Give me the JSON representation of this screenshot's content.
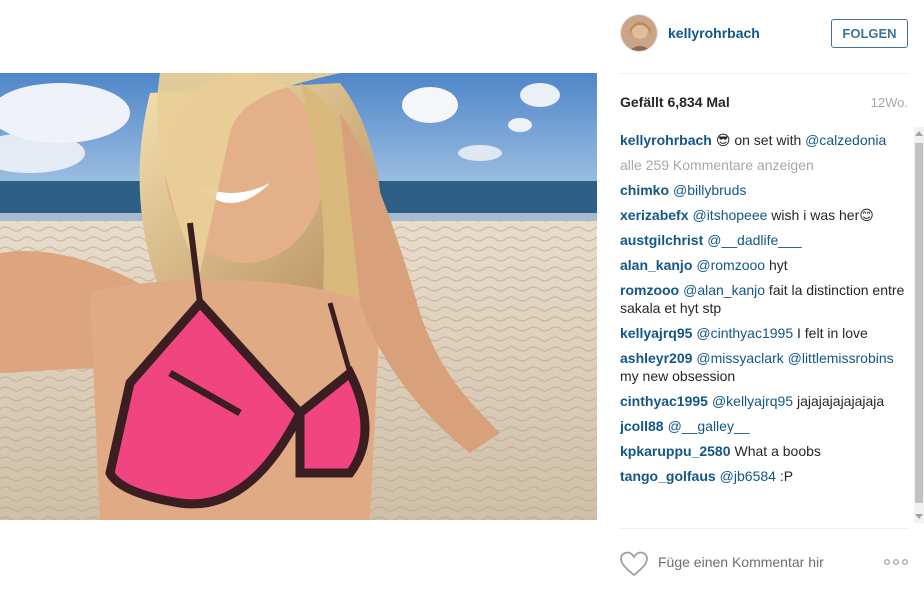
{
  "post": {
    "image_alt": "Selfie on a beach",
    "author": "kellyrohrbach",
    "follow_label": "FOLGEN",
    "likes_text": "Gefällt 6,834 Mal",
    "age_text": "12Wo."
  },
  "caption": {
    "user": "kellyrohrbach",
    "emoji": "😎",
    "text": " on set with ",
    "mention": "@calzedonia"
  },
  "view_all_comments": "alle 259 Kommentare anzeigen",
  "comments": [
    {
      "user": "chimko",
      "mention": "@billybruds",
      "text": ""
    },
    {
      "user": "xerizabefx",
      "mention": "@itshopeee",
      "text": " wish i was her😊"
    },
    {
      "user": "austgilchrist",
      "mention": "@__dadlife___",
      "text": ""
    },
    {
      "user": "alan_kanjo",
      "mention": "@romzooo",
      "text": " hyt"
    },
    {
      "user": "romzooo",
      "mention": "@alan_kanjo",
      "text": " fait la distinction entre sakala et hyt stp"
    },
    {
      "user": "kellyajrq95",
      "mention": "@cinthyac1995",
      "text": " I felt in love"
    },
    {
      "user": "ashleyr209",
      "mention": "@missyaclark @littlemissrobins",
      "text": " my new obsession"
    },
    {
      "user": "cinthyac1995",
      "mention": "@kellyajrq95",
      "text": " jajajajajajajaja"
    },
    {
      "user": "jcoll88",
      "mention": "@__galley__",
      "text": ""
    },
    {
      "user": "kpkaruppu_2580",
      "mention": "",
      "text": "What a boobs"
    },
    {
      "user": "tango_golfaus",
      "mention": "@jb6584",
      "text": " :P"
    }
  ],
  "footer": {
    "comment_placeholder": "Füge einen Kommentar hir",
    "heart_icon": "heart-outline",
    "more_icon": "ellipsis"
  },
  "colors": {
    "link": "#125688",
    "follow_border": "#3f729b",
    "muted": "#a5a7aa",
    "bikini_pink": "#f0457e"
  }
}
